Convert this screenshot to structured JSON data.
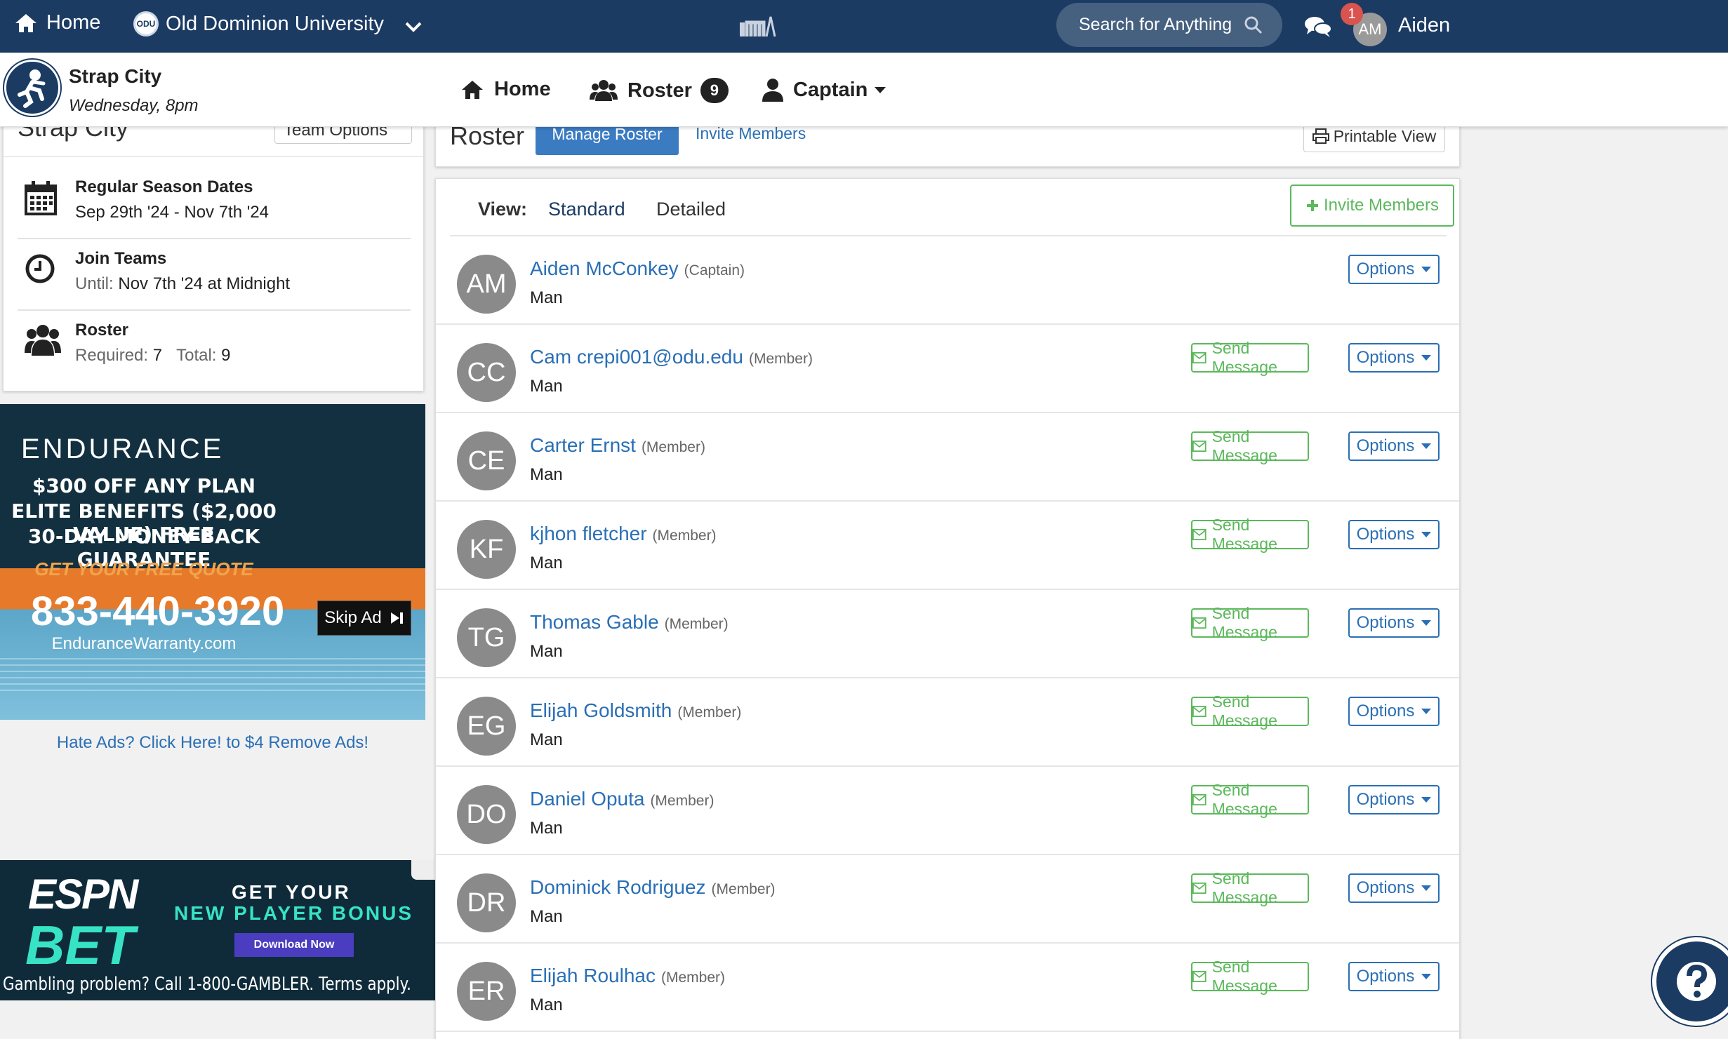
{
  "topnav": {
    "home": "Home",
    "school": "Old Dominion University",
    "school_logo_text": "ODU",
    "search": "Search for Anything",
    "notifications": "1",
    "avatar": "AM",
    "user": "Aiden"
  },
  "team": {
    "name": "Strap City",
    "schedule": "Wednesday, 8pm",
    "nav": {
      "home": "Home",
      "roster": "Roster",
      "roster_count": "9",
      "captain": "Captain"
    }
  },
  "left_panel": {
    "title": "Strap City",
    "team_options": "Team Options",
    "season": {
      "label": "Regular Season Dates",
      "value": "Sep 29th '24 - Nov 7th '24"
    },
    "join": {
      "label": "Join Teams",
      "prefix": "Until:",
      "value": "Nov 7th '24 at Midnight"
    },
    "roster": {
      "label": "Roster",
      "required_label": "Required:",
      "required": "7",
      "total_label": "Total:",
      "total": "9"
    }
  },
  "ads": {
    "endurance": {
      "brand": "ENDURANCE",
      "line1": "$300 OFF ANY PLAN",
      "line2": "ELITE BENEFITS ($2,000 VALUE) FREE",
      "line3": "30-DAY MONEY-BACK GUARANTEE",
      "quote": "GET YOUR FREE QUOTE",
      "phone": "833-440-3920",
      "web": "EnduranceWarranty.com"
    },
    "skip": "Skip Ad",
    "hate": "Hate Ads? Click Here! to $4 Remove Ads!",
    "espn": {
      "espn": "ESPN",
      "bet": "BET",
      "line1": "GET YOUR",
      "line2": "NEW PLAYER BONUS",
      "cta": "Download Now",
      "disclaimer": "Gambling problem? Call 1-800-GAMBLER. Terms apply."
    }
  },
  "roster_header": {
    "title": "Roster",
    "manage": "Manage Roster",
    "invite": "Invite Members",
    "printable": "Printable View"
  },
  "roster": {
    "view_label": "View:",
    "view_standard": "Standard",
    "view_detailed": "Detailed",
    "invite_button": "Invite Members",
    "send_label": "Send Message",
    "options_label": "Options",
    "members": [
      {
        "initials": "AM",
        "name": "Aiden McConkey",
        "role": "(Captain)",
        "gender": "Man"
      },
      {
        "initials": "CC",
        "name": "Cam crepi001@odu.edu",
        "role": "(Member)",
        "gender": "Man"
      },
      {
        "initials": "CE",
        "name": "Carter Ernst",
        "role": "(Member)",
        "gender": "Man"
      },
      {
        "initials": "KF",
        "name": "kjhon fletcher",
        "role": "(Member)",
        "gender": "Man"
      },
      {
        "initials": "TG",
        "name": "Thomas Gable",
        "role": "(Member)",
        "gender": "Man"
      },
      {
        "initials": "EG",
        "name": "Elijah Goldsmith",
        "role": "(Member)",
        "gender": "Man"
      },
      {
        "initials": "DO",
        "name": "Daniel Oputa",
        "role": "(Member)",
        "gender": "Man"
      },
      {
        "initials": "DR",
        "name": "Dominick Rodriguez",
        "role": "(Member)",
        "gender": "Man"
      },
      {
        "initials": "ER",
        "name": "Elijah Roulhac",
        "role": "(Member)",
        "gender": "Man"
      }
    ]
  }
}
